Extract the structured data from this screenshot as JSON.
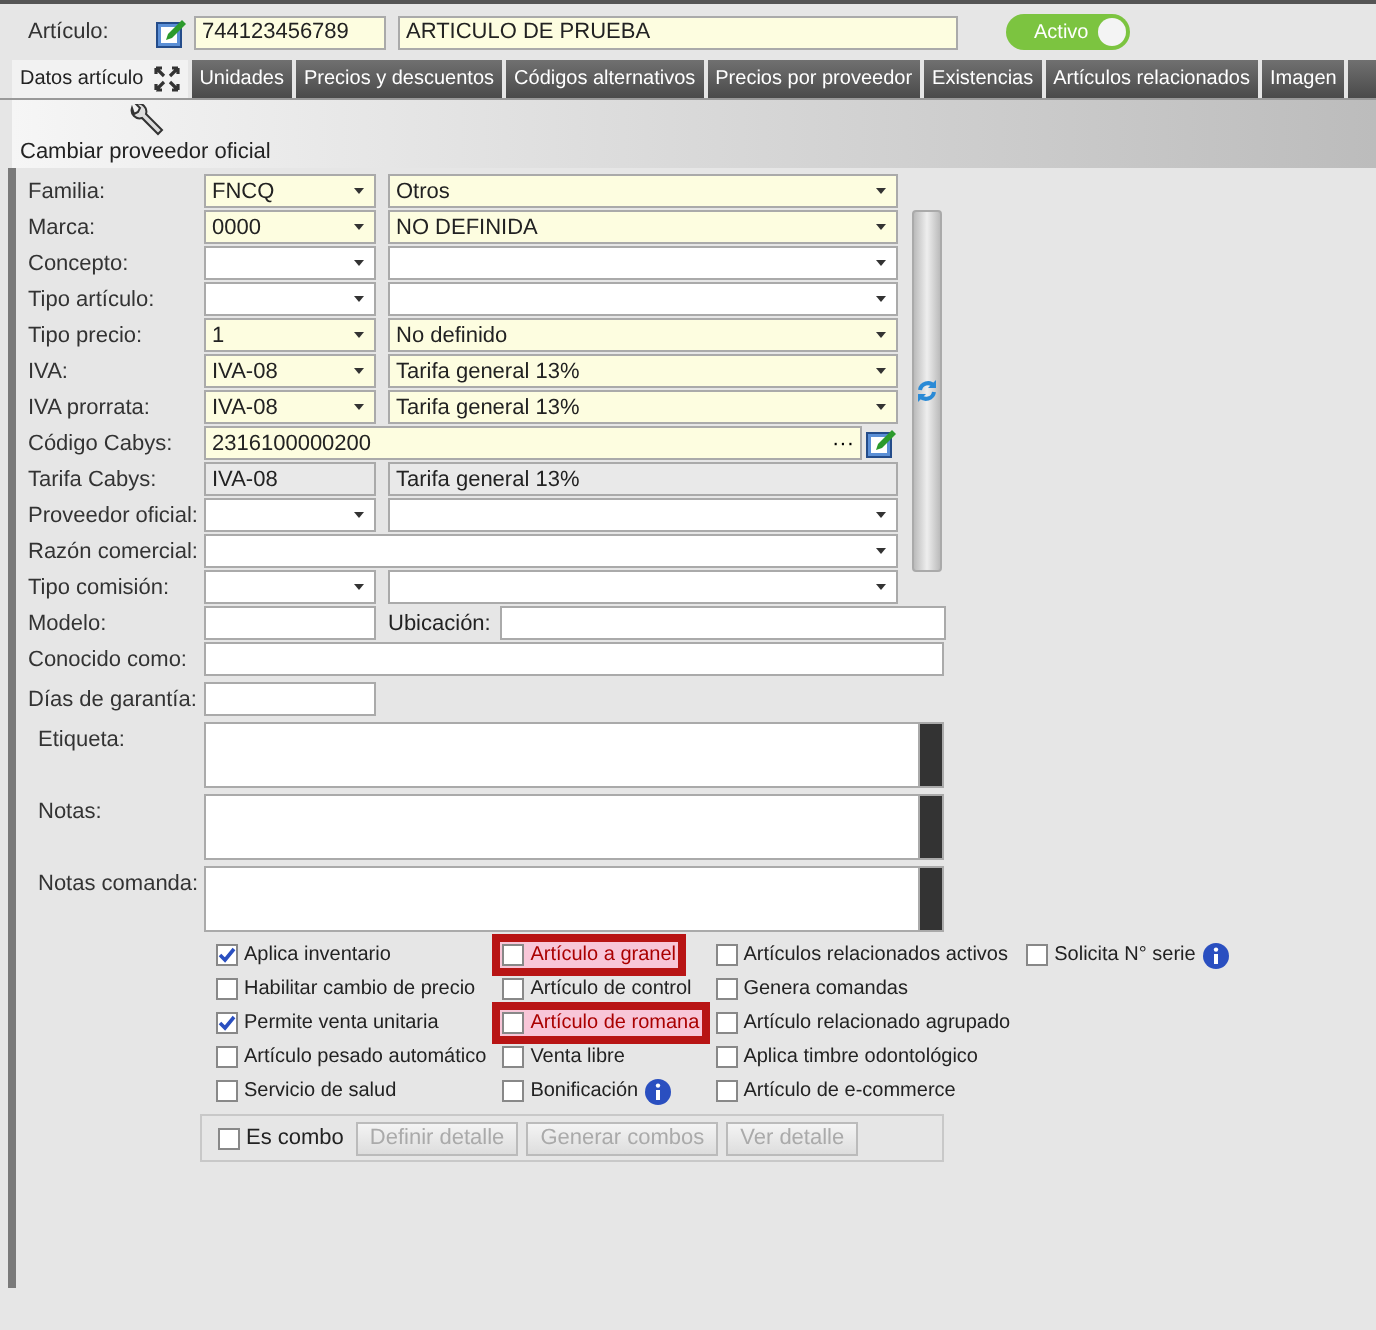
{
  "header": {
    "label": "Artículo:",
    "code": "744123456789",
    "name": "ARTICULO DE PRUEBA",
    "status": {
      "label": "Activo",
      "on": true
    }
  },
  "tabs": [
    {
      "label": "Datos artículo",
      "selected": true
    },
    {
      "label": "Unidades",
      "selected": false
    },
    {
      "label": "Precios y descuentos",
      "selected": false
    },
    {
      "label": "Códigos alternativos",
      "selected": false
    },
    {
      "label": "Precios por proveedor",
      "selected": false
    },
    {
      "label": "Existencias",
      "selected": false
    },
    {
      "label": "Artículos relacionados",
      "selected": false
    },
    {
      "label": "Imagen",
      "selected": false
    }
  ],
  "toolbar": {
    "button": "Cambiar proveedor oficial"
  },
  "fields": [
    {
      "kind": "pair",
      "label": "Familia:",
      "code": "FNCQ",
      "value": "Otros"
    },
    {
      "kind": "pair",
      "label": "Marca:",
      "code": "0000",
      "value": "NO DEFINIDA"
    },
    {
      "kind": "pair",
      "label": "Concepto:"
    },
    {
      "kind": "pair",
      "label": "Tipo artículo:"
    },
    {
      "kind": "pair",
      "label": "Tipo precio:",
      "code": "1",
      "value": "No definido"
    },
    {
      "kind": "pair",
      "label": "IVA:",
      "code": "IVA-08",
      "value": "Tarifa general 13%"
    },
    {
      "kind": "pair",
      "label": "IVA prorrata:",
      "code": "IVA-08",
      "value": "Tarifa general 13%"
    },
    {
      "kind": "lookup",
      "label": "Código Cabys:",
      "value": "2316100000200",
      "button": "···"
    },
    {
      "kind": "readonly",
      "label": "Tarifa Cabys:",
      "code": "IVA-08",
      "value": "Tarifa general 13%"
    },
    {
      "kind": "pair",
      "label": "Proveedor oficial:"
    },
    {
      "kind": "wide",
      "label": "Razón comercial:"
    },
    {
      "kind": "pair",
      "label": "Tipo comisión:"
    }
  ],
  "more_fields": [
    {
      "kind": "split",
      "label": "Modelo:",
      "second_label": "Ubicación:"
    },
    {
      "kind": "text",
      "label": "Conocido como:"
    },
    {
      "kind": "short",
      "label": "Días de garantía:"
    },
    {
      "kind": "memo",
      "label": "Etiqueta:"
    },
    {
      "kind": "memo",
      "label": "Notas:"
    },
    {
      "kind": "memo",
      "label": "Notas comanda:"
    }
  ],
  "options": [
    [
      {
        "label": "Aplica inventario",
        "checked": true
      },
      {
        "label": "Habilitar cambio de precio",
        "checked": false
      },
      {
        "label": "Permite venta unitaria",
        "checked": true
      },
      {
        "label": "Artículo pesado automático",
        "checked": false
      },
      {
        "label": "Servicio de salud",
        "checked": false
      }
    ],
    [
      {
        "label": "Artículo a granel",
        "checked": false,
        "highlighted": true
      },
      {
        "label": "Artículo de control",
        "checked": false,
        "highlighted": false
      },
      {
        "label": "Artículo de romana",
        "checked": false,
        "highlighted": true
      },
      {
        "label": "Venta libre",
        "checked": false,
        "highlighted": false
      },
      {
        "label": "Bonificación",
        "checked": false,
        "highlighted": false,
        "info": true
      }
    ],
    [
      {
        "label": "Artículos relacionados activos",
        "checked": false
      },
      {
        "label": "Genera comandas",
        "checked": false
      },
      {
        "label": "Artículo relacionado agrupado",
        "checked": false
      },
      {
        "label": "Aplica timbre odontológico",
        "checked": false
      },
      {
        "label": "Artículo de e-commerce",
        "checked": false
      }
    ],
    [
      {
        "label": "Solicita N° serie",
        "checked": false,
        "info": true
      }
    ]
  ],
  "combo": {
    "label": "Es combo",
    "checked": false,
    "buttons": [
      {
        "label": "Definir detalle",
        "disabled": true
      },
      {
        "label": "Generar combos",
        "disabled": true
      },
      {
        "label": "Ver detalle",
        "disabled": true
      }
    ]
  }
}
